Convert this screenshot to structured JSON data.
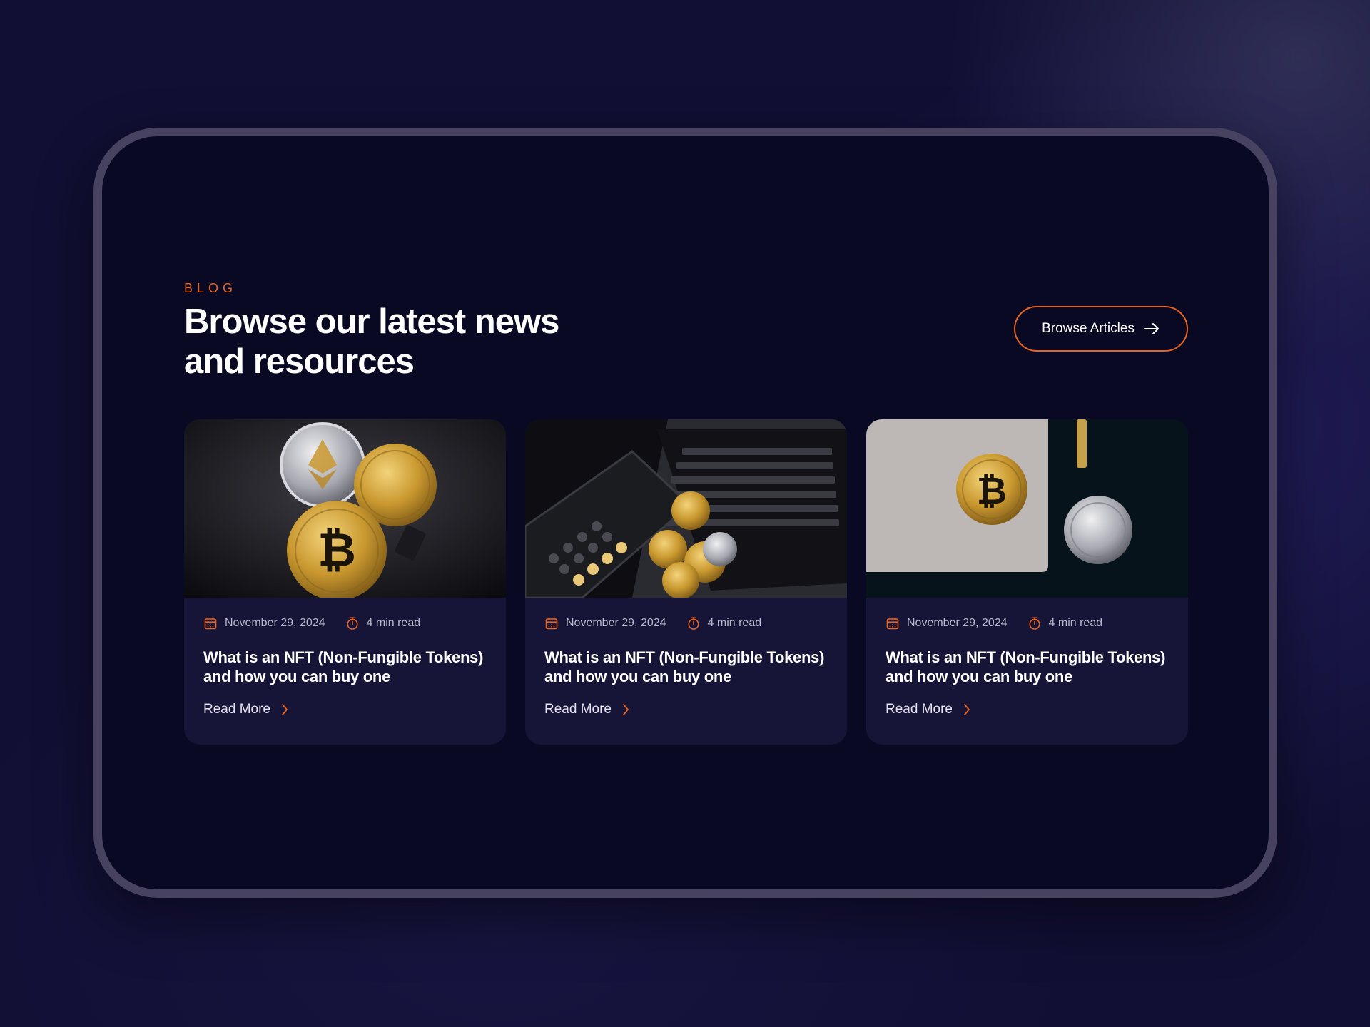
{
  "section": {
    "eyebrow": "BLOG",
    "headline": "Browse our latest news and resources",
    "browse_button": "Browse Articles"
  },
  "colors": {
    "accent": "#e8631e",
    "page_background": "#110f33",
    "panel_background": "#0a0923",
    "card_background": "#161437"
  },
  "cards": [
    {
      "image_icon": "crypto-coins-image",
      "date": "November 29, 2024",
      "date_icon": "calendar-icon",
      "read_time": "4 min read",
      "read_time_icon": "stopwatch-icon",
      "title": "What is an NFT (Non-Fungible Tokens) and how you can buy one",
      "link": "Read More",
      "link_icon": "chevron-right-icon"
    },
    {
      "image_icon": "laptop-calculator-coins-image",
      "date": "November 29, 2024",
      "date_icon": "calendar-icon",
      "read_time": "4 min read",
      "read_time_icon": "stopwatch-icon",
      "title": "What is an NFT (Non-Fungible Tokens) and how you can buy one",
      "link": "Read More",
      "link_icon": "chevron-right-icon"
    },
    {
      "image_icon": "bitcoin-on-laptop-image",
      "date": "November 29, 2024",
      "date_icon": "calendar-icon",
      "read_time": "4 min read",
      "read_time_icon": "stopwatch-icon",
      "title": "What is an NFT (Non-Fungible Tokens) and how you can buy one",
      "link": "Read More",
      "link_icon": "chevron-right-icon"
    }
  ]
}
